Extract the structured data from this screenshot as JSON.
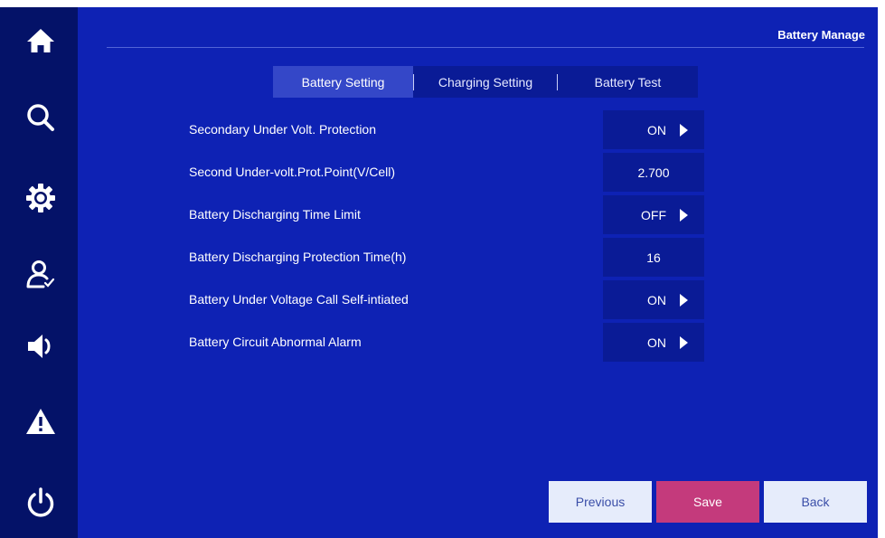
{
  "header": {
    "title": "Battery Manage"
  },
  "tabs": [
    {
      "label": "Battery Setting",
      "active": true
    },
    {
      "label": "Charging Setting",
      "active": false
    },
    {
      "label": "Battery Test",
      "active": false
    }
  ],
  "settings": [
    {
      "label": "Secondary Under Volt. Protection",
      "value": "ON",
      "kind": "toggle"
    },
    {
      "label": "Second Under-volt.Prot.Point(V/Cell)",
      "value": "2.700",
      "kind": "number"
    },
    {
      "label": "Battery Discharging Time Limit",
      "value": "OFF",
      "kind": "toggle"
    },
    {
      "label": "Battery Discharging Protection Time(h)",
      "value": "16",
      "kind": "number"
    },
    {
      "label": "Battery Under Voltage Call Self-intiated",
      "value": "ON",
      "kind": "toggle"
    },
    {
      "label": "Battery Circuit Abnormal Alarm",
      "value": "ON",
      "kind": "toggle"
    }
  ],
  "footer": {
    "previous_label": "Previous",
    "save_label": "Save",
    "back_label": "Back"
  },
  "sidebar": {
    "icons": [
      "home-icon",
      "search-icon",
      "gear-icon",
      "user-check-icon",
      "speaker-icon",
      "warning-icon",
      "power-icon"
    ]
  },
  "colors": {
    "background": "#0e22b4",
    "sidebar": "#041268",
    "field": "#0a1b96",
    "active_tab": "#3447c8",
    "save_button": "#c43a7c",
    "secondary_button": "#e6ecfb"
  }
}
